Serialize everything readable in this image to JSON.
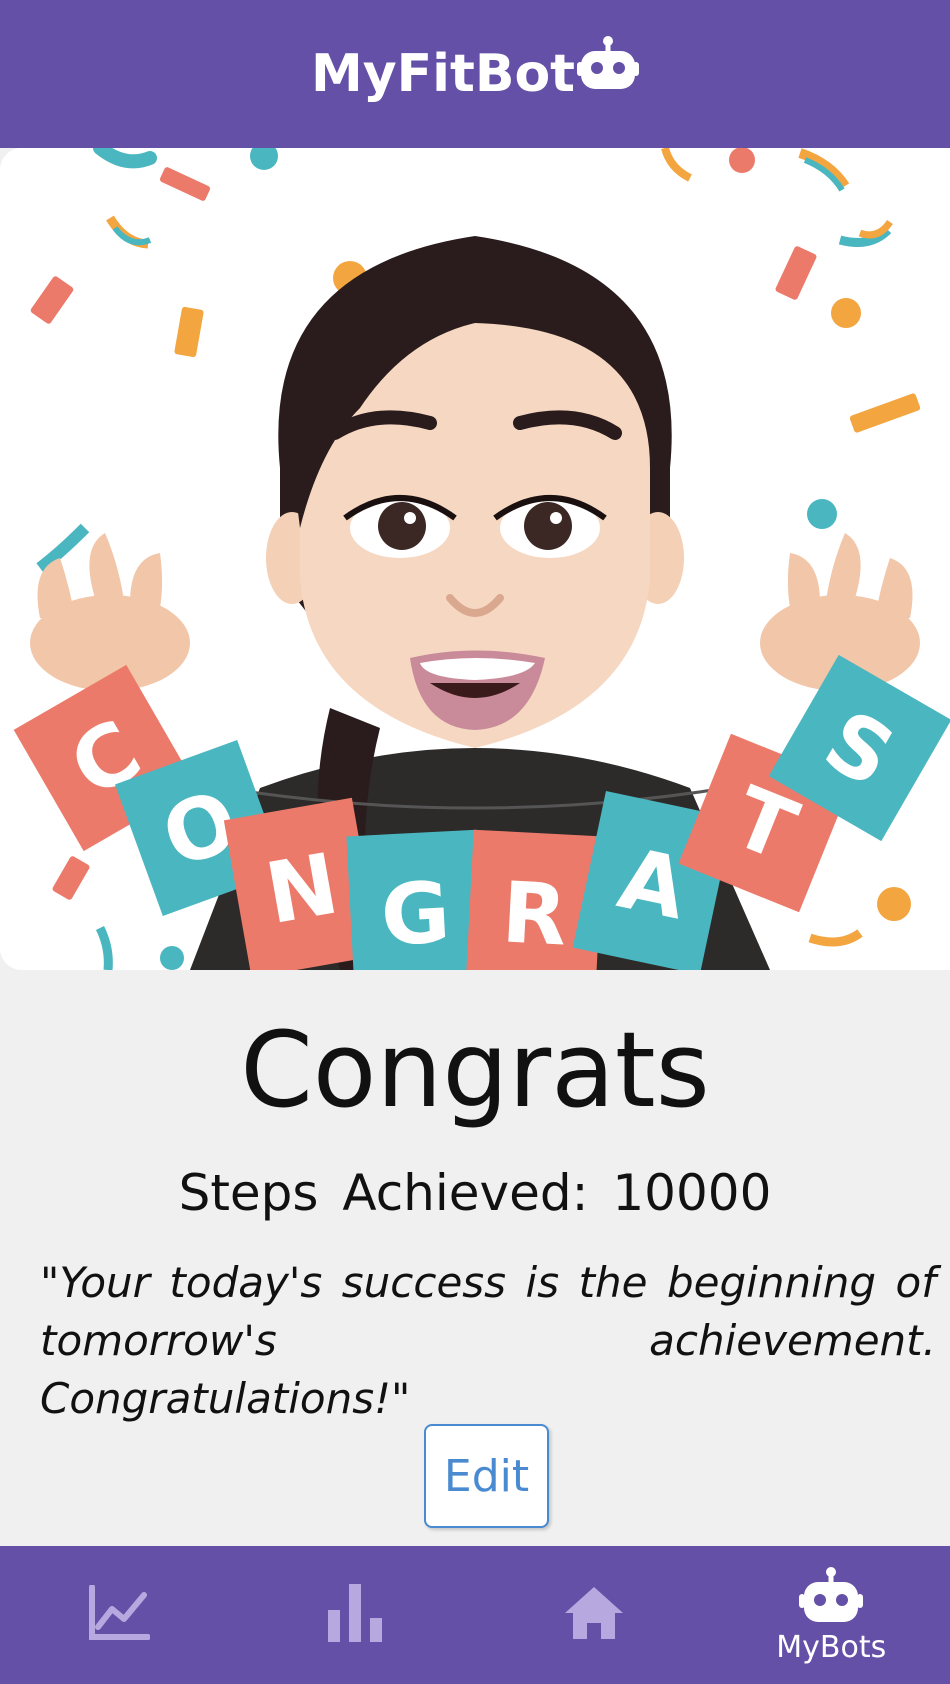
{
  "header": {
    "app_title": "MyFitBot",
    "brand_icon": "robot-icon",
    "bg_color": "#6550a8"
  },
  "hero": {
    "image": "congrats-avatar-banner",
    "banner_text": "CONGRATS"
  },
  "main": {
    "title": "Congrats",
    "steps_text": "Steps Achieved: 10000",
    "quote": "\"Your today's success is the beginning of tomorrow's achievement. Congratulations!\"",
    "edit_label": "Edit"
  },
  "bottom_nav": {
    "items": [
      {
        "icon": "line-chart-icon",
        "label": "",
        "active": false
      },
      {
        "icon": "bar-chart-icon",
        "label": "",
        "active": false
      },
      {
        "icon": "home-icon",
        "label": "",
        "active": false
      },
      {
        "icon": "robot-icon",
        "label": "MyBots",
        "active": true
      }
    ],
    "inactive_color": "#b7a9df",
    "active_color": "#ffffff"
  }
}
